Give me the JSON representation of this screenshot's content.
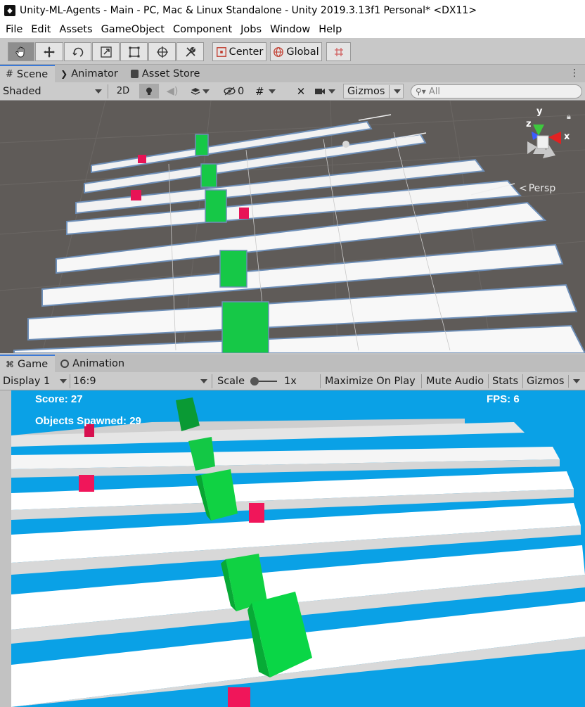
{
  "window": {
    "title": "Unity-ML-Agents - Main - PC, Mac & Linux Standalone - Unity 2019.3.13f1 Personal* <DX11>"
  },
  "menu": [
    "File",
    "Edit",
    "Assets",
    "GameObject",
    "Component",
    "Jobs",
    "Window",
    "Help"
  ],
  "toolbar": {
    "tools": [
      "hand-tool",
      "move-tool",
      "rotate-tool",
      "scale-tool",
      "rect-tool",
      "transform-tool",
      "custom-tool"
    ],
    "pivot_label": "Center",
    "space_label": "Global"
  },
  "scene_panel": {
    "tabs": [
      "Scene",
      "Animator",
      "Asset Store"
    ],
    "shading_mode": "Shaded",
    "mode_2d": "2D",
    "hidden_count": "0",
    "gizmos_label": "Gizmos",
    "search_placeholder": "All",
    "persp_label": "Persp",
    "gizmo_axes": {
      "x": "x",
      "y": "y",
      "z": "z"
    }
  },
  "game_panel": {
    "tabs": [
      "Game",
      "Animation"
    ],
    "display": "Display 1",
    "aspect": "16:9",
    "scale_label": "Scale",
    "scale_value": "1x",
    "maximize_label": "Maximize On Play",
    "mute_label": "Mute Audio",
    "stats_label": "Stats",
    "gizmos_label": "Gizmos",
    "hud": {
      "score": "Score: 27",
      "spawned": "Objects Spawned: 29",
      "fps": "FPS: 6"
    }
  },
  "colors": {
    "accent_tab": "#3a79d8",
    "scene_bg": "#5f5b58",
    "game_sky": "#0aa1e6",
    "lane_blue": "#10b4f0",
    "agent_green": "#09d846",
    "target_red": "#f0165a"
  }
}
